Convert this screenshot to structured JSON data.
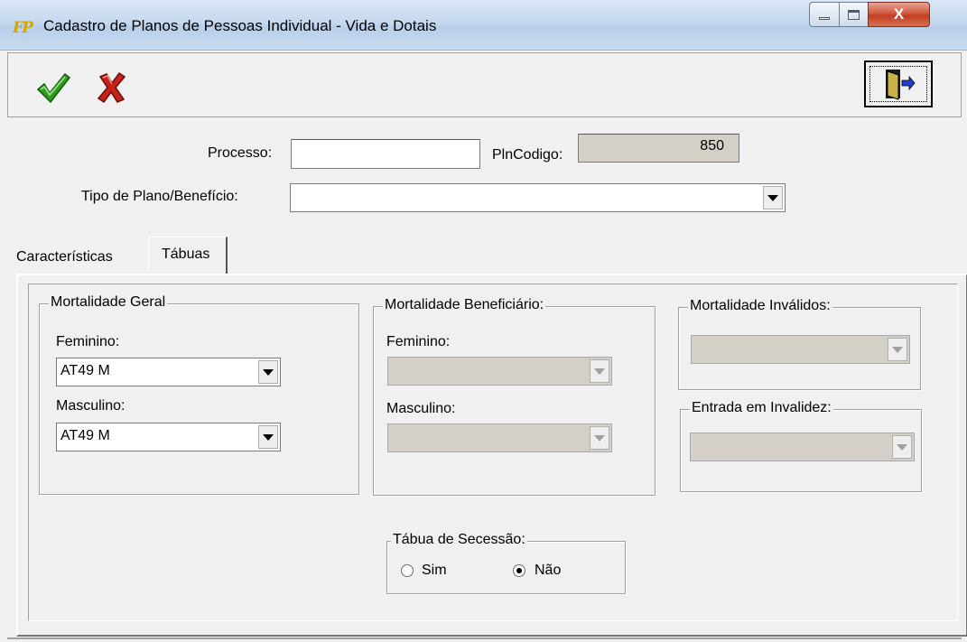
{
  "window": {
    "icon_text": "FP",
    "title": "Cadastro de Planos de Pessoas Individual - Vida e Dotais",
    "close_glyph": "X"
  },
  "toolbar": {
    "confirm_icon": "checkmark-icon",
    "cancel_icon": "red-x-icon",
    "exit_icon": "exit-door-icon"
  },
  "form": {
    "processo_label": "Processo:",
    "processo_value": "",
    "plncodigo_label": "PlnCodigo:",
    "plncodigo_value": "850",
    "tipo_label": "Tipo de Plano/Benefício:",
    "tipo_value": ""
  },
  "tabs": [
    {
      "label": "Características",
      "active": false
    },
    {
      "label": "Tábuas",
      "active": true
    }
  ],
  "mortalidade_geral": {
    "title": "Mortalidade Geral",
    "feminino_label": "Feminino:",
    "feminino_value": "AT49 M",
    "masculino_label": "Masculino:",
    "masculino_value": "AT49 M"
  },
  "mortalidade_beneficiario": {
    "title": "Mortalidade Beneficiário:",
    "feminino_label": "Feminino:",
    "feminino_value": "",
    "masculino_label": "Masculino:",
    "masculino_value": ""
  },
  "mortalidade_invalidos": {
    "title": "Mortalidade Inválidos:",
    "value": ""
  },
  "entrada_invalidez": {
    "title": "Entrada em Invalidez:",
    "value": ""
  },
  "tabua_secessao": {
    "title": "Tábua de Secessão:",
    "options": [
      {
        "label": "Sim",
        "checked": false
      },
      {
        "label": "Não",
        "checked": true
      }
    ]
  }
}
